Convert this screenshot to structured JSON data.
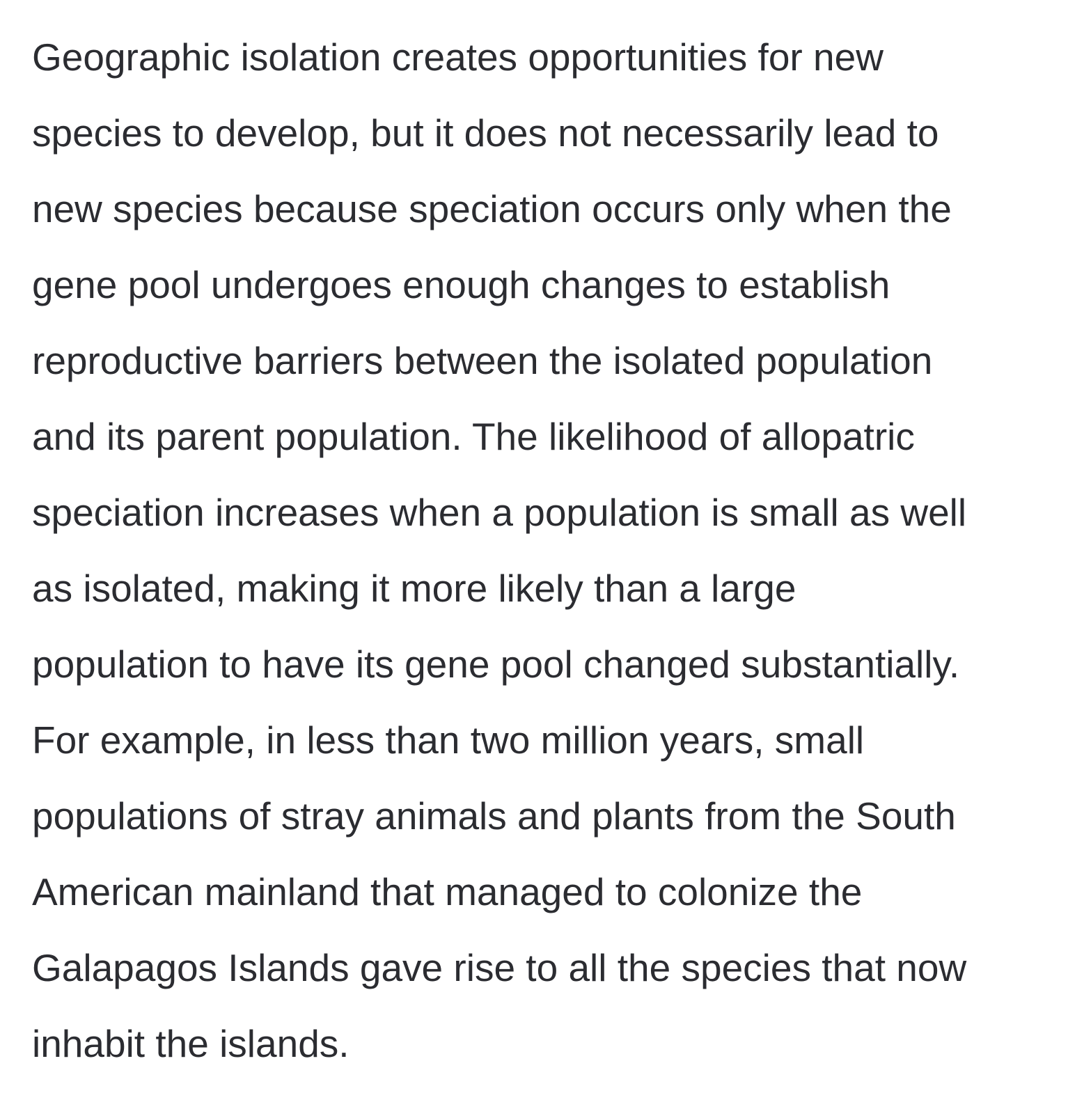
{
  "paragraph": {
    "lines": [
      "Geographic isolation creates opportunities for new",
      "species to develop, but it does not necessarily lead to",
      "new species because speciation occurs only when the",
      "gene pool undergoes enough changes to establish",
      "reproductive barriers between the isolated population",
      "and its parent population. The likelihood of allopatric",
      "speciation increases when a population is small as well",
      "as isolated, making it more likely than a large",
      "population to have its gene pool changed substantially.",
      "For example, in less than two million years, small",
      "populations of stray animals and plants from the South",
      "American mainland that managed to colonize the",
      "Galapagos Islands gave rise to all the species that now",
      "inhabit the islands."
    ]
  }
}
